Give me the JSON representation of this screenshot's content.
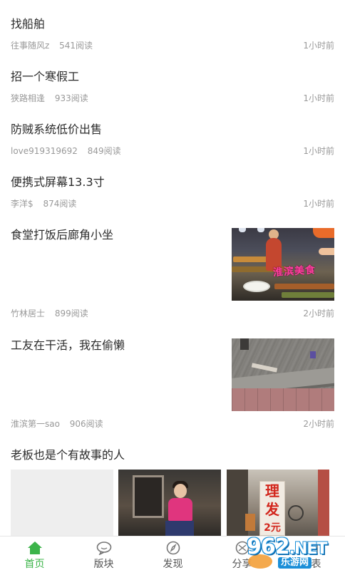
{
  "posts": [
    {
      "title": "找船舶",
      "author": "往事随风z",
      "reads": "541阅读",
      "time": "1小时前"
    },
    {
      "title": "招一个寒假工",
      "author": "狭路相逢",
      "reads": "933阅读",
      "time": "1小时前"
    },
    {
      "title": "防贼系统低价出售",
      "author": "love919319692",
      "reads": "849阅读",
      "time": "1小时前"
    },
    {
      "title": "便携式屏幕13.3寸",
      "author": "李洋$",
      "reads": "874阅读",
      "time": "1小时前"
    },
    {
      "title": "食堂打饭后廊角小坐",
      "author": "竹林居士",
      "reads": "899阅读",
      "time": "2小时前",
      "thumb_caption": "淮滨美食"
    },
    {
      "title": "工友在干活，我在偷懒",
      "author": "淮滨第一sao",
      "reads": "906阅读",
      "time": "2小时前"
    },
    {
      "title": "老板也是个有故事的人",
      "sign_text": [
        "理",
        "发",
        "2元"
      ]
    }
  ],
  "tabbar": {
    "tabs": [
      {
        "label": "首页",
        "icon": "home-icon",
        "active": true
      },
      {
        "label": "版块",
        "icon": "chat-bubble-icon",
        "active": false
      },
      {
        "label": "发现",
        "icon": "compass-icon",
        "active": false
      },
      {
        "label": "分享",
        "icon": "share-icon",
        "active": false
      },
      {
        "label": "发表",
        "icon": "post-icon",
        "active": false
      }
    ],
    "active_color": "#3cb44a"
  },
  "watermark": {
    "brand": "962",
    "suffix": ".NET",
    "site": "乐游网"
  }
}
